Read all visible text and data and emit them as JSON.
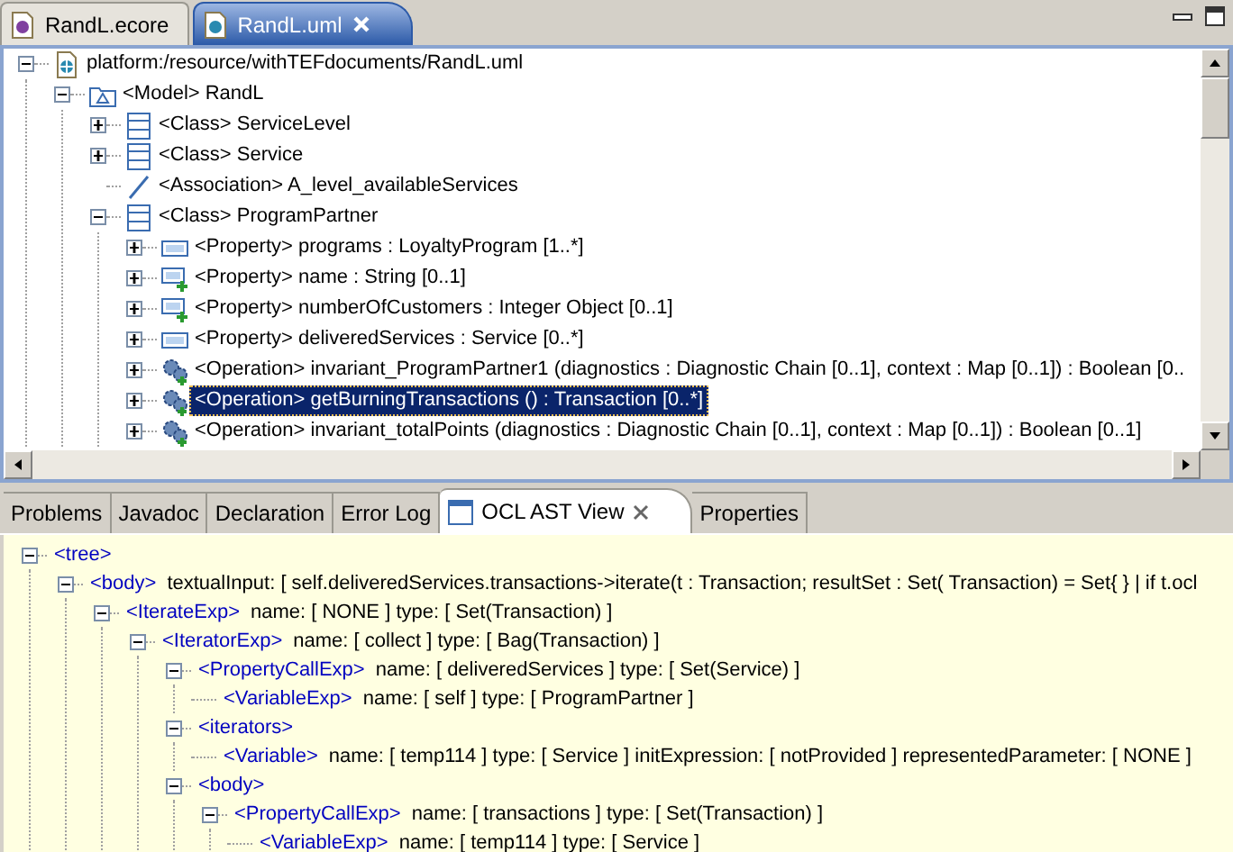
{
  "editor_tabs": [
    {
      "label": "RandL.ecore",
      "selected": false
    },
    {
      "label": "RandL.uml",
      "selected": true
    }
  ],
  "model_tree": [
    {
      "kind": "file",
      "label": "platform:/resource/withTEFdocuments/RandL.uml",
      "expandable": true,
      "expanded": true,
      "selected": false,
      "children": [
        {
          "kind": "model",
          "label": "<Model> RandL",
          "expandable": true,
          "expanded": true,
          "selected": false,
          "children": [
            {
              "kind": "class",
              "label": "<Class> ServiceLevel",
              "expandable": true,
              "expanded": false,
              "selected": false
            },
            {
              "kind": "class",
              "label": "<Class> Service",
              "expandable": true,
              "expanded": false,
              "selected": false
            },
            {
              "kind": "association",
              "label": "<Association> A_level_availableServices",
              "expandable": false,
              "selected": false
            },
            {
              "kind": "class",
              "label": "<Class> ProgramPartner",
              "expandable": true,
              "expanded": true,
              "selected": false,
              "children": [
                {
                  "kind": "property",
                  "label": "<Property> programs : LoyaltyProgram [1..*]",
                  "expandable": true,
                  "expanded": false,
                  "selected": false
                },
                {
                  "kind": "property-add",
                  "label": "<Property> name : String [0..1]",
                  "expandable": true,
                  "expanded": false,
                  "selected": false
                },
                {
                  "kind": "property-add",
                  "label": "<Property> numberOfCustomers : Integer Object [0..1]",
                  "expandable": true,
                  "expanded": false,
                  "selected": false
                },
                {
                  "kind": "property",
                  "label": "<Property> deliveredServices : Service [0..*]",
                  "expandable": true,
                  "expanded": false,
                  "selected": false
                },
                {
                  "kind": "operation",
                  "label": "<Operation> invariant_ProgramPartner1 (diagnostics : Diagnostic Chain [0..1], context : Map [0..1]) : Boolean [0..",
                  "expandable": true,
                  "expanded": false,
                  "selected": false
                },
                {
                  "kind": "operation",
                  "label": "<Operation> getBurningTransactions () : Transaction [0..*]",
                  "expandable": true,
                  "expanded": false,
                  "selected": true
                },
                {
                  "kind": "operation",
                  "label": "<Operation> invariant_totalPoints (diagnostics : Diagnostic Chain [0..1], context : Map [0..1]) : Boolean [0..1]",
                  "expandable": true,
                  "expanded": false,
                  "selected": false
                }
              ]
            }
          ]
        }
      ]
    }
  ],
  "view_tabs": [
    {
      "label": "Problems",
      "selected": false
    },
    {
      "label": "Javadoc",
      "selected": false
    },
    {
      "label": "Declaration",
      "selected": false
    },
    {
      "label": "Error Log",
      "selected": false
    },
    {
      "label": "OCL AST View",
      "selected": true
    },
    {
      "label": "Properties",
      "selected": false
    }
  ],
  "ast_tree": [
    {
      "tag": "<tree>",
      "expandable": true,
      "expanded": true,
      "children": [
        {
          "tag": "<body>",
          "text": "textualInput: [ self.deliveredServices.transactions->iterate(t : Transaction; resultSet : Set( Transaction) = Set{ } | if t.ocl",
          "expandable": true,
          "expanded": true,
          "children": [
            {
              "tag": "<IterateExp>",
              "text": "name: [ NONE ]  type: [ Set(Transaction) ]",
              "expandable": true,
              "expanded": true,
              "children": [
                {
                  "tag": "<IteratorExp>",
                  "text": "name: [ collect ]  type: [ Bag(Transaction) ]",
                  "expandable": true,
                  "expanded": true,
                  "children": [
                    {
                      "tag": "<PropertyCallExp>",
                      "text": "name: [ deliveredServices ]  type: [ Set(Service) ]",
                      "expandable": true,
                      "expanded": true,
                      "children": [
                        {
                          "tag": "<VariableExp>",
                          "text": "name: [ self ]  type: [ ProgramPartner ]",
                          "expandable": false
                        }
                      ]
                    },
                    {
                      "tag": "<iterators>",
                      "expandable": true,
                      "expanded": true,
                      "children": [
                        {
                          "tag": "<Variable>",
                          "text": "name: [ temp114 ]  type: [ Service ]  initExpression: [ notProvided ]  representedParameter: [ NONE ]",
                          "expandable": false
                        }
                      ]
                    },
                    {
                      "tag": "<body>",
                      "expandable": true,
                      "expanded": true,
                      "children": [
                        {
                          "tag": "<PropertyCallExp>",
                          "text": "name: [ transactions ]  type: [ Set(Transaction) ]",
                          "expandable": true,
                          "expanded": true,
                          "children": [
                            {
                              "tag": "<VariableExp>",
                              "text": "name: [ temp114 ]  type: [ Service ]",
                              "expandable": false
                            }
                          ]
                        }
                      ]
                    }
                  ]
                }
              ]
            }
          ]
        }
      ]
    }
  ]
}
